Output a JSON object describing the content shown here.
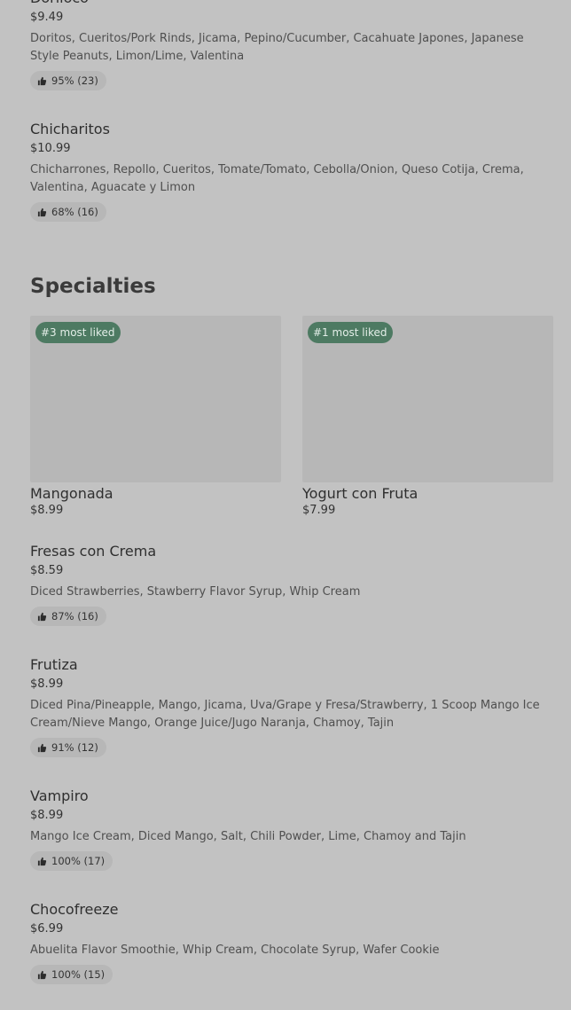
{
  "top_items": [
    {
      "name": "Doriloco",
      "price": "$9.49",
      "description": "Doritos, Cueritos/Pork Rinds, Jicama, Pepino/Cucumber, Cacahuate Japones, Japanese Style Peanuts, Limon/Lime, Valentina",
      "rating": "95% (23)"
    },
    {
      "name": "Chicharitos",
      "price": "$10.99",
      "description": "Chicharrones, Repollo, Cueritos, Tomate/Tomato, Cebolla/Onion, Queso Cotija, Crema, Valentina, Aguacate y Limon",
      "rating": "68% (16)"
    }
  ],
  "section": {
    "title": "Specialties"
  },
  "featured": [
    {
      "badge": "#3 most liked",
      "name": "Mangonada",
      "price": "$8.99"
    },
    {
      "badge": "#1 most liked",
      "name": "Yogurt con Fruta",
      "price": "$7.99"
    }
  ],
  "items": [
    {
      "name": "Fresas con Crema",
      "price": "$8.59",
      "description": "Diced Strawberries, Stawberry Flavor Syrup, Whip Cream",
      "rating": "87% (16)"
    },
    {
      "name": "Frutiza",
      "price": "$8.99",
      "description": "Diced Pina/Pineapple, Mango, Jicama, Uva/Grape y Fresa/Strawberry, 1 Scoop Mango Ice Cream/Nieve Mango, Orange Juice/Jugo Naranja, Chamoy, Tajin",
      "rating": "91% (12)"
    },
    {
      "name": "Vampiro",
      "price": "$8.99",
      "description": "Mango Ice Cream, Diced Mango, Salt, Chili Powder, Lime, Chamoy and Tajin",
      "rating": "100% (17)"
    },
    {
      "name": "Chocofreeze",
      "price": "$6.99",
      "description": "Abuelita Flavor Smoothie, Whip Cream, Chocolate Syrup, Wafer Cookie",
      "rating": "100% (15)"
    }
  ],
  "icons": {
    "rating": "thumbs-up-icon"
  },
  "colors": {
    "background": "#c2c2c2",
    "badge": "#4d7a62",
    "pill": "#b7b7b7"
  }
}
